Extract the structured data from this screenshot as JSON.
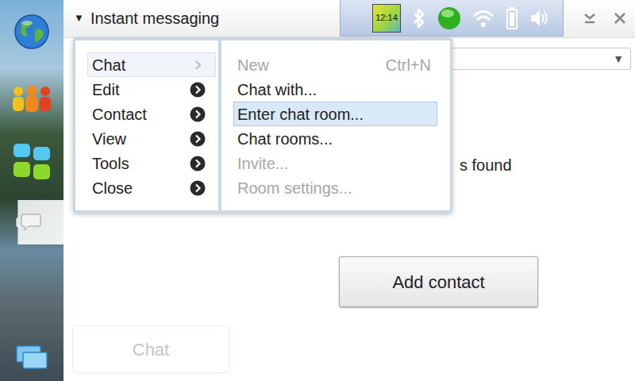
{
  "window": {
    "title": "Instant messaging",
    "title_arrow": "▼"
  },
  "status_bar": {
    "clock": "12:14"
  },
  "sidebar": {
    "items": [
      {
        "kind": "web",
        "selected": false
      },
      {
        "kind": "contacts",
        "selected": false
      },
      {
        "kind": "apps",
        "selected": false
      },
      {
        "kind": "chat",
        "selected": true
      }
    ]
  },
  "dropdown": {
    "arrow": "▼"
  },
  "menu": {
    "items": [
      {
        "label": "Chat",
        "selected": true
      },
      {
        "label": "Edit",
        "selected": false
      },
      {
        "label": "Contact",
        "selected": false
      },
      {
        "label": "View",
        "selected": false
      },
      {
        "label": "Tools",
        "selected": false
      },
      {
        "label": "Close",
        "selected": false
      }
    ],
    "submenu": [
      {
        "label": "New",
        "shortcut": "Ctrl+N",
        "disabled": true,
        "selected": false
      },
      {
        "label": "Chat with...",
        "shortcut": "",
        "disabled": false,
        "selected": false
      },
      {
        "label": "Enter chat room...",
        "shortcut": "",
        "disabled": false,
        "selected": true
      },
      {
        "label": "Chat rooms...",
        "shortcut": "",
        "disabled": false,
        "selected": false
      },
      {
        "label": "Invite...",
        "shortcut": "",
        "disabled": true,
        "selected": false
      },
      {
        "label": "Room settings...",
        "shortcut": "",
        "disabled": true,
        "selected": false
      }
    ]
  },
  "content": {
    "status_text": "s found",
    "add_contact": "Add contact",
    "chat_button": {
      "label": "Chat",
      "disabled": true
    }
  }
}
